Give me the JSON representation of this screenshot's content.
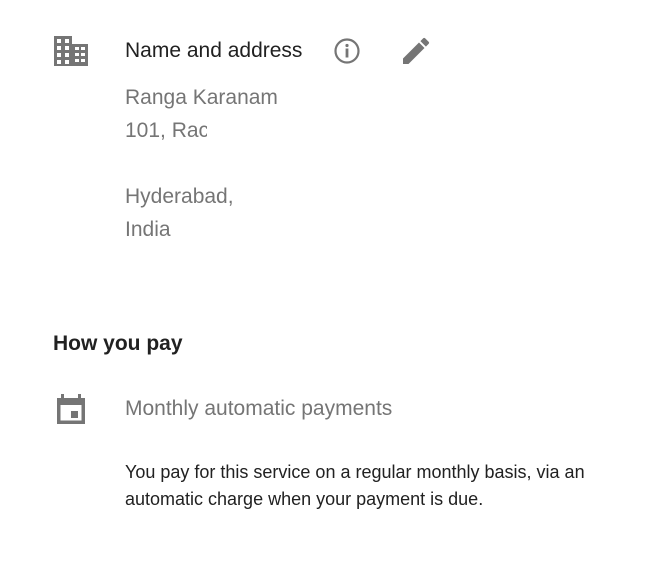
{
  "account": {
    "section_title": "Name and address",
    "icons": {
      "building": "building-icon",
      "info": "info-icon",
      "edit": "pencil-icon"
    },
    "address_lines": [
      "Ranga Karanam",
      "101, Rac",
      "",
      "Hyderabad,",
      "India"
    ]
  },
  "payment": {
    "heading": "How you pay",
    "icons": {
      "calendar": "calendar-icon"
    },
    "method": "Monthly automatic payments",
    "description": "You pay for this service on a regular monthly basis, via an automatic charge when your payment is due."
  },
  "colors": {
    "icon_gray": "#757575",
    "primary_text": "#212121",
    "secondary_text": "#757575"
  }
}
